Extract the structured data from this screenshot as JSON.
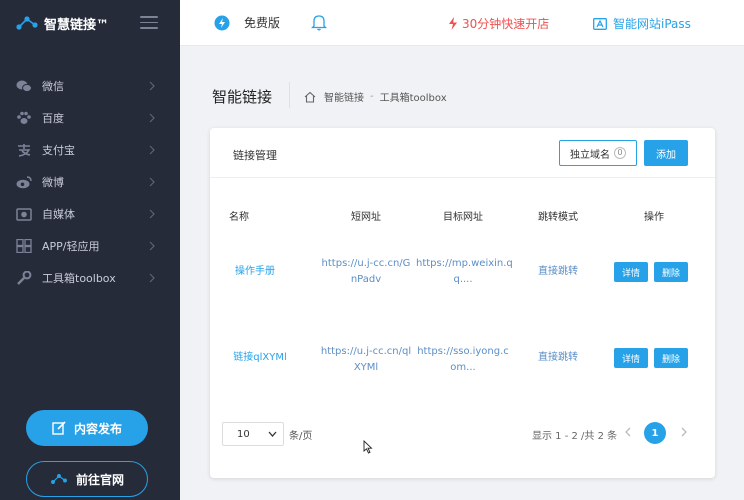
{
  "brand": {
    "name": "智慧链接™"
  },
  "sidebar": {
    "items": [
      {
        "label": "微信",
        "icon": "wechat-icon"
      },
      {
        "label": "百度",
        "icon": "paw-icon"
      },
      {
        "label": "支付宝",
        "icon": "alipay-icon"
      },
      {
        "label": "微博",
        "icon": "weibo-icon"
      },
      {
        "label": "自媒体",
        "icon": "media-icon"
      },
      {
        "label": "APP/轻应用",
        "icon": "apps-icon"
      },
      {
        "label": "工具箱toolbox",
        "icon": "wrench-icon"
      }
    ],
    "publish_label": "内容发布",
    "site_label": "前往官网"
  },
  "topbar": {
    "edition": "免费版",
    "fast_open": "30分钟快速开店",
    "ipass": "智能网站iPass"
  },
  "page": {
    "title": "智能链接",
    "breadcrumb": [
      "智能链接",
      "工具箱toolbox"
    ]
  },
  "card": {
    "title": "链接管理",
    "domain_label": "独立域名",
    "domain_count": "0",
    "add_label": "添加"
  },
  "table": {
    "headers": [
      "名称",
      "短网址",
      "目标网址",
      "跳转模式",
      "操作"
    ],
    "rows": [
      {
        "name": "操作手册",
        "short_1": "https://u.j-cc.cn/G",
        "short_2": "nPadv",
        "target_1": "https://mp.weixin.q",
        "target_2": "q....",
        "mode": "直接跳转",
        "detail": "详情",
        "delete": "删除"
      },
      {
        "name": "链接qlXYMl",
        "short_1": "https://u.j-cc.cn/ql",
        "short_2": "XYMl",
        "target_1": "https://sso.iyong.c",
        "target_2": "om...",
        "mode": "直接跳转",
        "detail": "详情",
        "delete": "删除"
      }
    ]
  },
  "pager": {
    "page_size": "10",
    "unit": "条/页",
    "info": "显示 1 - 2 /共 2 条",
    "current": "1"
  },
  "colors": {
    "accent": "#27a2e8",
    "sidebar": "#262b3a",
    "alert": "#f0504f"
  }
}
